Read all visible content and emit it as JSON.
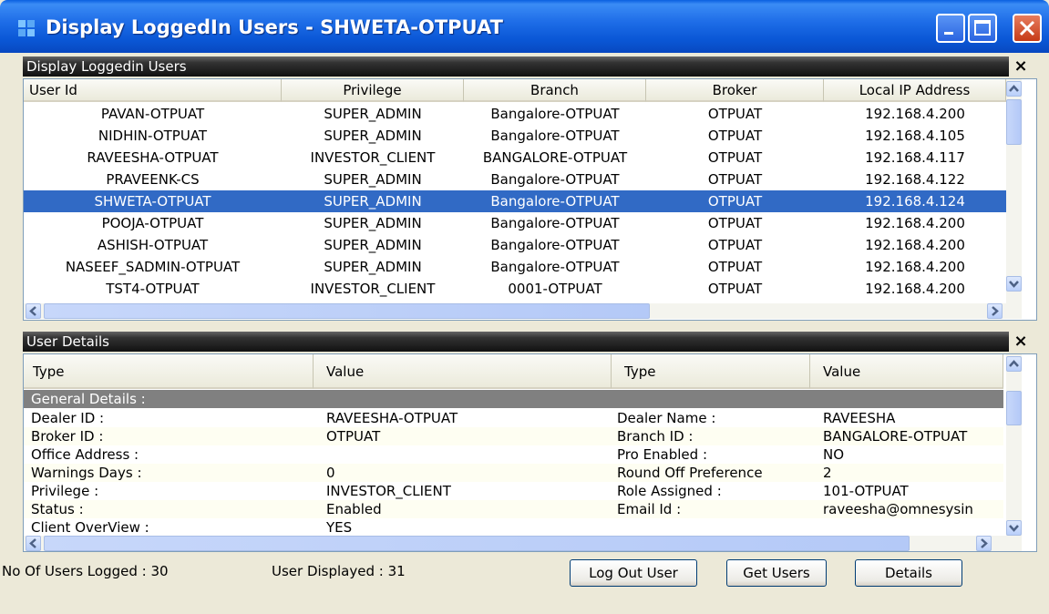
{
  "window": {
    "title": "Display LoggedIn Users - SHWETA-OTPUAT"
  },
  "users_panel": {
    "title": "Display Loggedin Users",
    "close_glyph": "×",
    "columns": [
      "User Id",
      "Privilege",
      "Branch",
      "Broker",
      "Local IP Address"
    ],
    "rows": [
      {
        "user_id": "PAVAN-OTPUAT",
        "privilege": "SUPER_ADMIN",
        "branch": "Bangalore-OTPUAT",
        "broker": "OTPUAT",
        "ip": "192.168.4.200"
      },
      {
        "user_id": "NIDHIN-OTPUAT",
        "privilege": "SUPER_ADMIN",
        "branch": "Bangalore-OTPUAT",
        "broker": "OTPUAT",
        "ip": "192.168.4.105"
      },
      {
        "user_id": "RAVEESHA-OTPUAT",
        "privilege": "INVESTOR_CLIENT",
        "branch": "BANGALORE-OTPUAT",
        "broker": "OTPUAT",
        "ip": "192.168.4.117"
      },
      {
        "user_id": "PRAVEENK-CS",
        "privilege": "SUPER_ADMIN",
        "branch": "Bangalore-OTPUAT",
        "broker": "OTPUAT",
        "ip": "192.168.4.122"
      },
      {
        "user_id": "SHWETA-OTPUAT",
        "privilege": "SUPER_ADMIN",
        "branch": "Bangalore-OTPUAT",
        "broker": "OTPUAT",
        "ip": "192.168.4.124"
      },
      {
        "user_id": "POOJA-OTPUAT",
        "privilege": "SUPER_ADMIN",
        "branch": "Bangalore-OTPUAT",
        "broker": "OTPUAT",
        "ip": "192.168.4.200"
      },
      {
        "user_id": "ASHISH-OTPUAT",
        "privilege": "SUPER_ADMIN",
        "branch": "Bangalore-OTPUAT",
        "broker": "OTPUAT",
        "ip": "192.168.4.200"
      },
      {
        "user_id": "NASEEF_SADMIN-OTPUAT",
        "privilege": "SUPER_ADMIN",
        "branch": "Bangalore-OTPUAT",
        "broker": "OTPUAT",
        "ip": "192.168.4.200"
      },
      {
        "user_id": "TST4-OTPUAT",
        "privilege": "INVESTOR_CLIENT",
        "branch": "0001-OTPUAT",
        "broker": "OTPUAT",
        "ip": "192.168.4.200"
      }
    ],
    "selected_row_index": 4
  },
  "details_panel": {
    "title": "User Details",
    "close_glyph": "×",
    "columns": [
      "Type",
      "Value",
      "Type",
      "Value"
    ],
    "group_label": "General Details :",
    "rows": [
      {
        "type1": "Dealer ID :",
        "value1": "RAVEESHA-OTPUAT",
        "type2": "Dealer Name :",
        "value2": "RAVEESHA"
      },
      {
        "type1": "Broker ID :",
        "value1": "OTPUAT",
        "type2": "Branch ID :",
        "value2": "BANGALORE-OTPUAT"
      },
      {
        "type1": "Office Address :",
        "value1": "",
        "type2": "Pro Enabled :",
        "value2": "NO"
      },
      {
        "type1": "Warnings Days :",
        "value1": "0",
        "type2": "Round Off Preference",
        "value2": "2"
      },
      {
        "type1": "Privilege :",
        "value1": "INVESTOR_CLIENT",
        "type2": "Role Assigned :",
        "value2": "101-OTPUAT"
      },
      {
        "type1": "Status :",
        "value1": "Enabled",
        "type2": "Email Id :",
        "value2": "raveesha@omnesysin"
      },
      {
        "type1": "Client OverView :",
        "value1": "YES",
        "type2": "",
        "value2": ""
      }
    ]
  },
  "status": {
    "users_logged": "No Of Users Logged : 30",
    "users_displayed": "User Displayed : 31"
  },
  "buttons": {
    "logout": "Log Out User",
    "get_users": "Get Users",
    "details": "Details"
  },
  "colors": {
    "selection": "#316ac5",
    "titlebar": "#0a57d6",
    "panel_header": "#222222",
    "group_row": "#808080"
  }
}
